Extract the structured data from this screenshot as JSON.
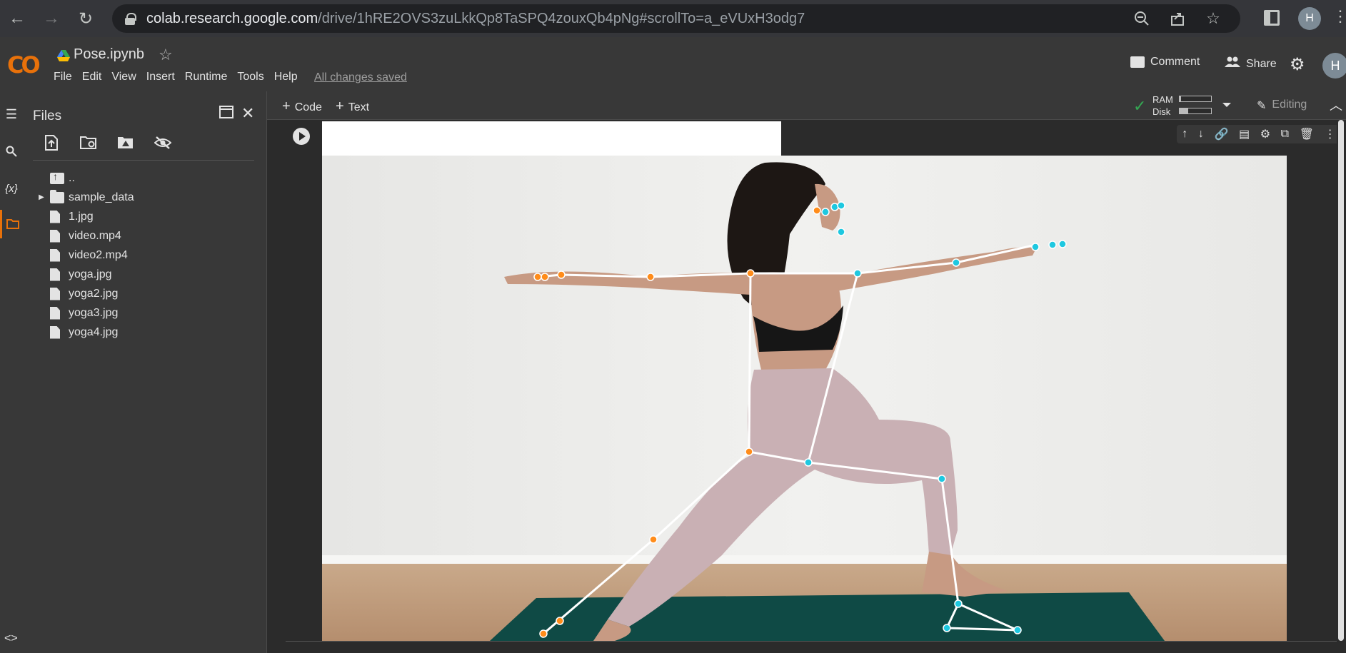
{
  "browser": {
    "url_host": "colab.research.google.com",
    "url_path": "/drive/1hRE2OVS3zuLkkQp8TaSPQ4zouxQb4pNg#scrollTo=a_eVUxH3odg7",
    "profile_initial": "H"
  },
  "header": {
    "logo_text": "CO",
    "notebook_title": "Pose.ipynb",
    "menu": [
      "File",
      "Edit",
      "View",
      "Insert",
      "Runtime",
      "Tools",
      "Help"
    ],
    "saved_status": "All changes saved",
    "comment_label": "Comment",
    "share_label": "Share",
    "avatar_initial": "H"
  },
  "files_panel": {
    "title": "Files",
    "items": [
      {
        "name": "..",
        "kind": "updir"
      },
      {
        "name": "sample_data",
        "kind": "folder"
      },
      {
        "name": "1.jpg",
        "kind": "file"
      },
      {
        "name": "video.mp4",
        "kind": "file"
      },
      {
        "name": "video2.mp4",
        "kind": "file"
      },
      {
        "name": "yoga.jpg",
        "kind": "file"
      },
      {
        "name": "yoga2.jpg",
        "kind": "file"
      },
      {
        "name": "yoga3.jpg",
        "kind": "file"
      },
      {
        "name": "yoga4.jpg",
        "kind": "file"
      }
    ]
  },
  "toolbar": {
    "add_code_label": "Code",
    "add_text_label": "Text",
    "ram_label": "RAM",
    "disk_label": "Disk",
    "ram_usage": 0.05,
    "disk_usage": 0.28,
    "editing_label": "Editing"
  },
  "colors": {
    "accent_orange": "#e8710a",
    "logo_yellow": "#f9ab00",
    "keypoint_left": "#ff8c1a",
    "keypoint_right": "#1ec8e0",
    "skeleton": "#ffffff",
    "ok_green": "#34a853"
  }
}
